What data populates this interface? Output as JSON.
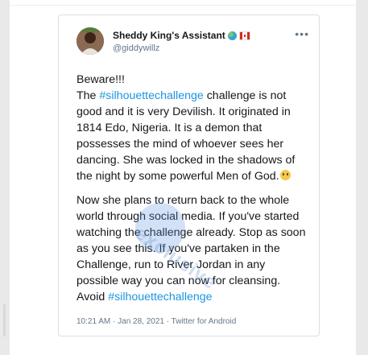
{
  "tweet": {
    "display_name": "Sheddy King's Assistant",
    "handle": "@giddywillz",
    "more_label": "•••",
    "paragraph1": {
      "intro": "Beware!!!",
      "the": "The ",
      "hashtag": "#silhouettechallenge",
      "text": " challenge is not good and it is very Devilish. It originated in 1814 Edo, Nigeria. It is a demon that possesses the mind of whoever sees her dancing. She was locked in the shadows of the night by some powerful Men of God."
    },
    "paragraph2": {
      "text": "Now she plans to return back to the whole world through social media. If you've started watching the challenge already. Stop as soon as you see this. If you've partaken in the Challenge, run to River Jordan in any possible way you can now for cleansing. Avoid ",
      "hashtag": "#silhouettechallenge"
    },
    "timestamp": "10:21 AM · Jan 28, 2021 · Twitter for Android"
  },
  "icons": {
    "avatar": "avatar",
    "globe": "globe-emoji-icon",
    "flag": "canada-flag-icon",
    "emoji": "grimacing-face-emoji-icon",
    "more": "more-options-icon"
  },
  "colors": {
    "hashtag": "#1b95e0",
    "text": "#14171a",
    "muted": "#657786"
  }
}
